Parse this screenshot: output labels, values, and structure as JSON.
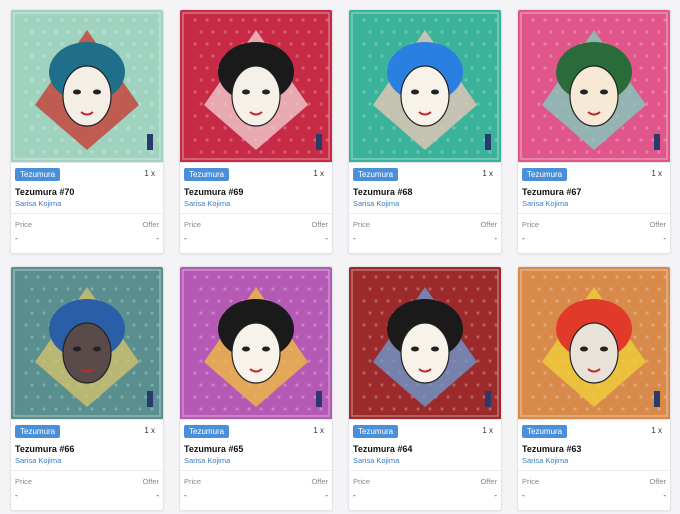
{
  "cards": [
    {
      "tag": "Tezumura",
      "qty": "1 x",
      "title": "Tezumura #70",
      "artist": "Sarisa Kojima",
      "price_label": "Price",
      "offer_label": "Offer",
      "price": "-",
      "offer": "-",
      "bg": "#9fd3c0",
      "accent": "#c8342c",
      "face": "#f3efe6",
      "hair": "#1f6f8b"
    },
    {
      "tag": "Tezumura",
      "qty": "1 x",
      "title": "Tezumura #69",
      "artist": "Sarisa Kojima",
      "price_label": "Price",
      "offer_label": "Offer",
      "price": "-",
      "offer": "-",
      "bg": "#c72a45",
      "accent": "#f3d4d4",
      "face": "#f5f0e8",
      "hair": "#1a1a1a"
    },
    {
      "tag": "Tezumura",
      "qty": "1 x",
      "title": "Tezumura #68",
      "artist": "Sarisa Kojima",
      "price_label": "Price",
      "offer_label": "Offer",
      "price": "-",
      "offer": "-",
      "bg": "#3bb39a",
      "accent": "#f3c7b8",
      "face": "#f7f3ea",
      "hair": "#2a7fe0"
    },
    {
      "tag": "Tezumura",
      "qty": "1 x",
      "title": "Tezumura #67",
      "artist": "Sarisa Kojima",
      "price_label": "Price",
      "offer_label": "Offer",
      "price": "-",
      "offer": "-",
      "bg": "#e0568a",
      "accent": "#7ed3c0",
      "face": "#f6e9d6",
      "hair": "#2a6b3a"
    },
    {
      "tag": "Tezumura",
      "qty": "1 x",
      "title": "Tezumura #66",
      "artist": "Sarisa Kojima",
      "price_label": "Price",
      "offer_label": "Offer",
      "price": "-",
      "offer": "-",
      "bg": "#5a8f8f",
      "accent": "#d9c46b",
      "face": "#5a4a4a",
      "hair": "#2a5fa8"
    },
    {
      "tag": "Tezumura",
      "qty": "1 x",
      "title": "Tezumura #65",
      "artist": "Sarisa Kojima",
      "price_label": "Price",
      "offer_label": "Offer",
      "price": "-",
      "offer": "-",
      "bg": "#b45ab4",
      "accent": "#f2c23a",
      "face": "#f7f3ea",
      "hair": "#1a1a1a"
    },
    {
      "tag": "Tezumura",
      "qty": "1 x",
      "title": "Tezumura #64",
      "artist": "Sarisa Kojima",
      "price_label": "Price",
      "offer_label": "Offer",
      "price": "-",
      "offer": "-",
      "bg": "#9c2a2a",
      "accent": "#6aa0d8",
      "face": "#f7f3ea",
      "hair": "#1a1a1a"
    },
    {
      "tag": "Tezumura",
      "qty": "1 x",
      "title": "Tezumura #63",
      "artist": "Sarisa Kojima",
      "price_label": "Price",
      "offer_label": "Offer",
      "price": "-",
      "offer": "-",
      "bg": "#d88a4a",
      "accent": "#f0d23a",
      "face": "#e8e2d8",
      "hair": "#e23a2a"
    }
  ]
}
